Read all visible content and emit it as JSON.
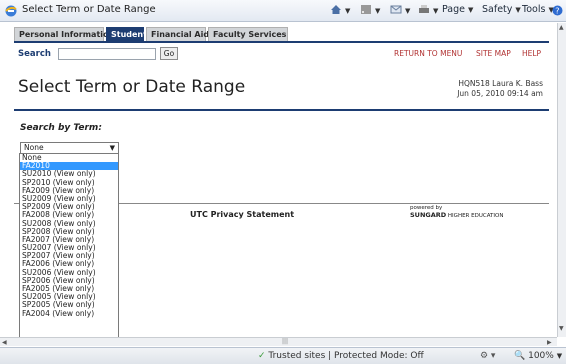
{
  "browser": {
    "title": "Select Term or Date Range",
    "menus": {
      "page": "Page",
      "safety": "Safety",
      "tools": "Tools"
    }
  },
  "tabs": [
    {
      "label": "Personal Information",
      "active": false
    },
    {
      "label": "Student",
      "active": true
    },
    {
      "label": "Financial Aid",
      "active": false
    },
    {
      "label": "Faculty Services",
      "active": false
    }
  ],
  "search": {
    "label": "Search",
    "value": "",
    "go_label": "Go"
  },
  "toplinks": {
    "return_to_menu": "RETURN TO MENU",
    "site_map": "SITE MAP",
    "help": "HELP"
  },
  "header": {
    "title": "Select Term or Date Range",
    "user": "HQN518 Laura K. Bass",
    "datetime": "Jun 05, 2010 09:14 am"
  },
  "form": {
    "search_by_term_label": "Search by Term:",
    "selected_value": "None"
  },
  "dropdown": {
    "options": [
      "None",
      "FA2010",
      "SU2010 (View only)",
      "SP2010 (View only)",
      "FA2009 (View only)",
      "SU2009 (View only)",
      "SP2009 (View only)",
      "FA2008 (View only)",
      "SU2008 (View only)",
      "SP2008 (View only)",
      "FA2007 (View only)",
      "SU2007 (View only)",
      "SP2007 (View only)",
      "FA2006 (View only)",
      "SU2006 (View only)",
      "SP2006 (View only)",
      "FA2005 (View only)",
      "SU2005 (View only)",
      "SP2005 (View only)",
      "FA2004 (View only)"
    ],
    "highlighted": "FA2010"
  },
  "footer": {
    "privacy": "UTC Privacy Statement",
    "powered_by": "powered by",
    "sungard": "SUNGARD",
    "higher_ed": "HIGHER EDUCATION"
  },
  "status": {
    "zone": "Trusted sites | Protected Mode: Off",
    "zoom": "100%"
  },
  "colors": {
    "accent": "#1d3d72",
    "link": "#b13333",
    "highlight": "#3399ff"
  }
}
